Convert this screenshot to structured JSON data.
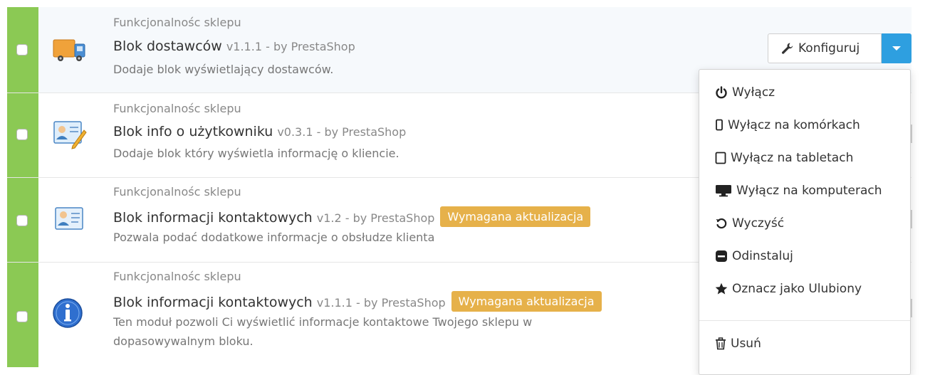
{
  "modules": [
    {
      "category": "Funkcjonalnośc sklepu",
      "name": "Blok dostawców",
      "version": "v1.1.1 - by PrestaShop",
      "description": "Dodaje blok wyświetlający dostawców.",
      "icon": "delivery-truck-icon"
    },
    {
      "category": "Funkcjonalnośc sklepu",
      "name": "Blok info o użytkowniku",
      "version": "v0.3.1 - by PrestaShop",
      "description": "Dodaje blok który wyświetla informację o kliencie.",
      "icon": "user-card-edit-icon"
    },
    {
      "category": "Funkcjonalnośc sklepu",
      "name": "Blok informacji kontaktowych",
      "version": "v1.2 - by PrestaShop",
      "badge": "Wymagana aktualizacja",
      "description": "Pozwala podać dodatkowe informacje o obsłudze klienta",
      "icon": "contact-card-icon"
    },
    {
      "category": "Funkcjonalnośc sklepu",
      "name": "Blok informacji kontaktowych",
      "version": "v1.1.1 - by PrestaShop",
      "badge": "Wymagana aktualizacja",
      "description_line1": "Ten moduł pozwoli Ci wyświetlić informacje kontaktowe Twojego sklepu w",
      "description_line2": "dopasowywalnym bloku.",
      "icon": "info-circle-icon"
    }
  ],
  "configure_button": {
    "label": "Konfiguruj",
    "icon": "wrench-icon"
  },
  "dropdown": {
    "items": [
      {
        "label": "Wyłącz",
        "icon": "power-icon"
      },
      {
        "label": "Wyłącz na komórkach",
        "icon": "mobile-icon"
      },
      {
        "label": "Wyłącz na tabletach",
        "icon": "tablet-icon"
      },
      {
        "label": "Wyłącz na komputerach",
        "icon": "desktop-icon"
      },
      {
        "label": "Wyczyść",
        "icon": "reset-icon"
      },
      {
        "label": "Odinstaluj",
        "icon": "minus-square-icon"
      },
      {
        "label": "Oznacz jako Ulubiony",
        "icon": "star-icon"
      },
      {
        "label": "Usuń",
        "icon": "trash-icon"
      }
    ]
  },
  "colors": {
    "enabled_stripe": "#8bc954",
    "primary": "#2e9fe0",
    "badge": "#e6b14a"
  }
}
